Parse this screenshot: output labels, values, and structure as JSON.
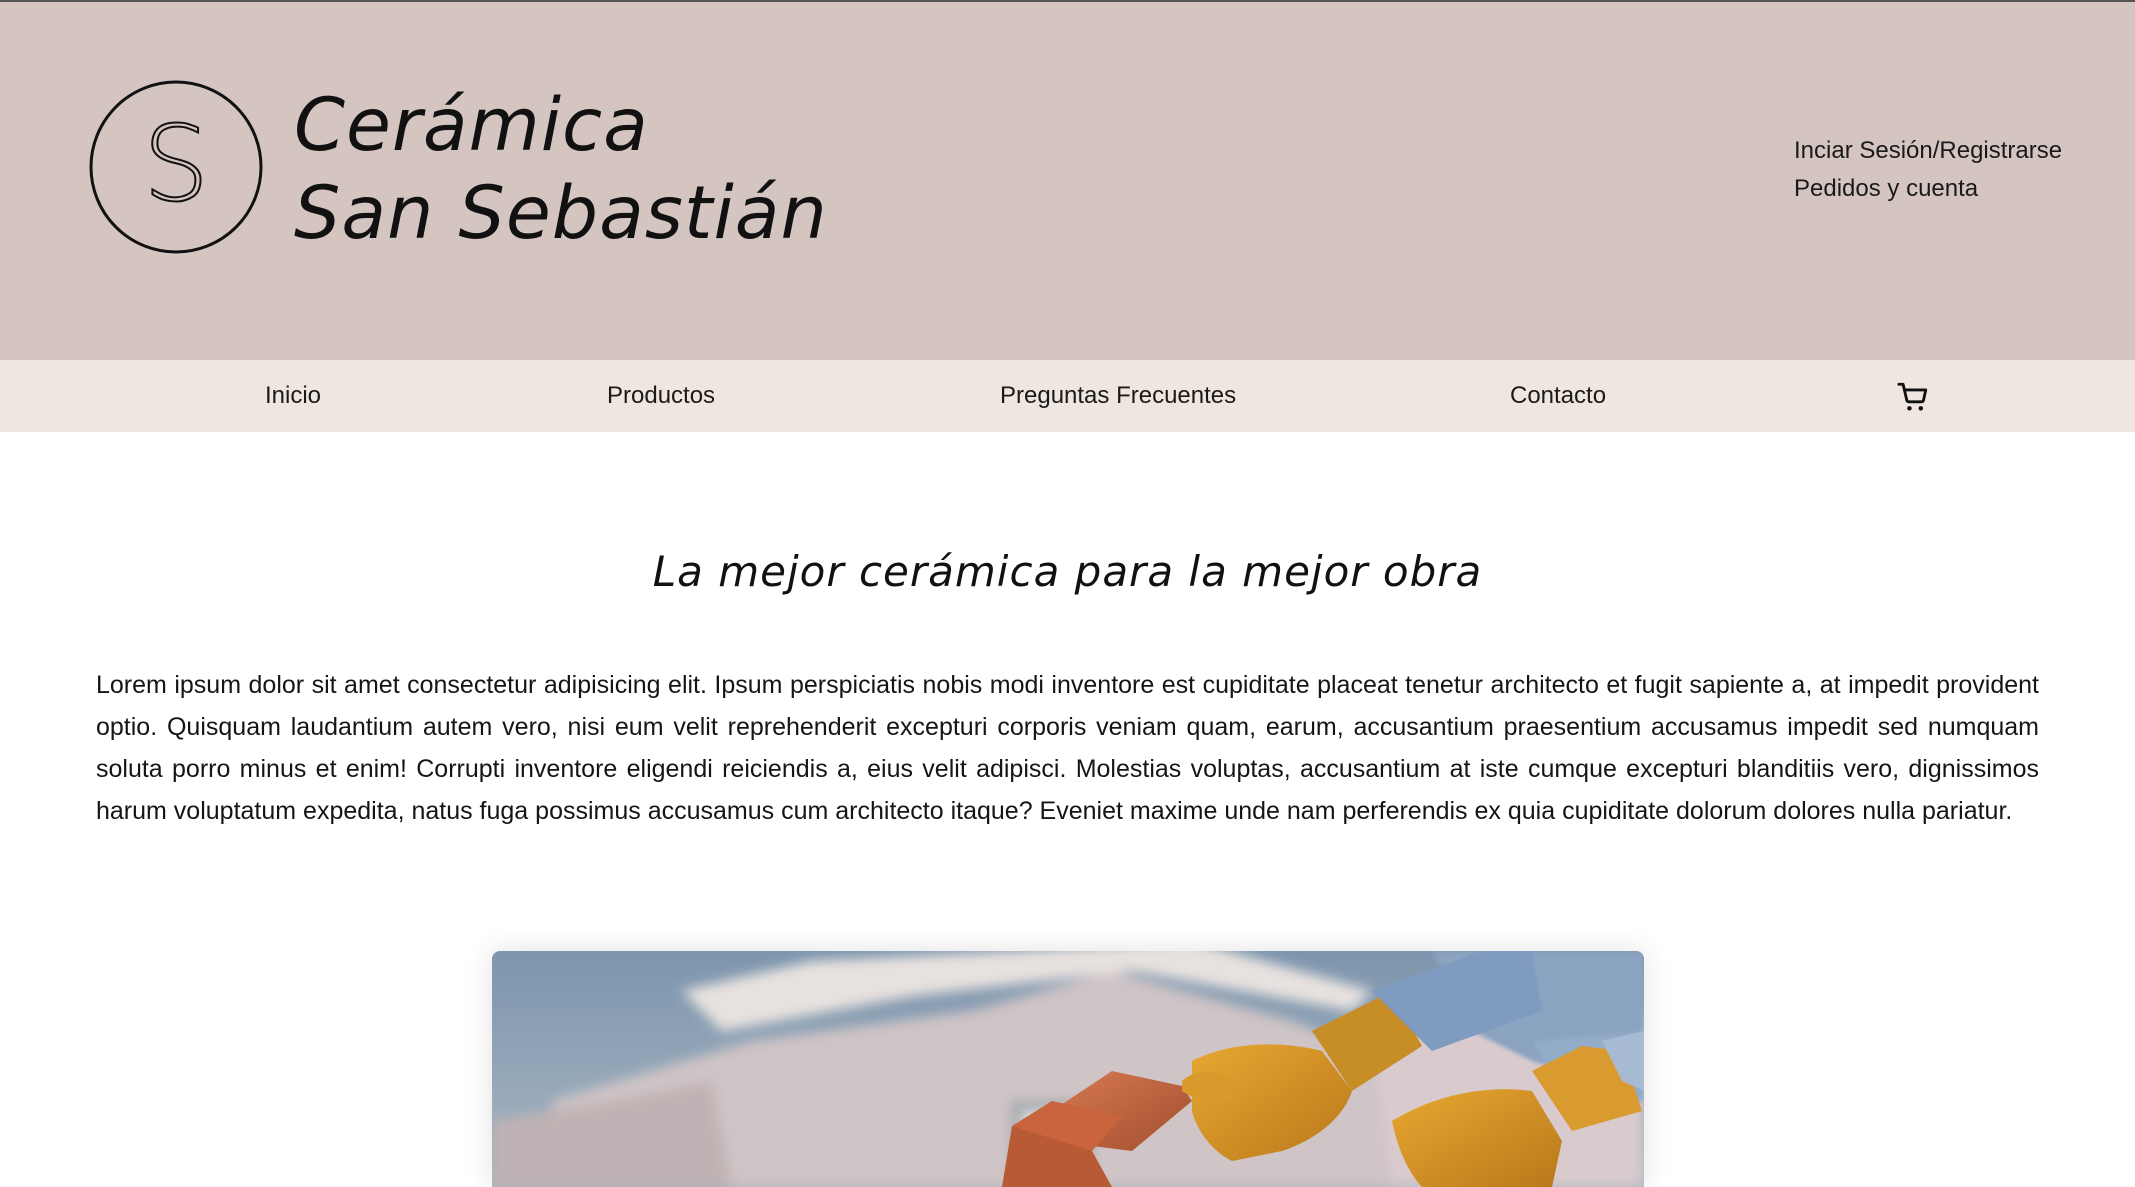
{
  "header": {
    "logo_letter": "S",
    "brand_line1": "Cerámica",
    "brand_line2": "San Sebastián",
    "account": {
      "login_label": "Inciar Sesión/Registrarse",
      "orders_label": "Pedidos y cuenta"
    },
    "background_color": "#d4c5c1"
  },
  "nav": {
    "items": [
      {
        "label": "Inicio"
      },
      {
        "label": "Productos"
      },
      {
        "label": "Preguntas Frecuentes"
      },
      {
        "label": "Contacto"
      }
    ],
    "cart_icon": "shopping-cart-icon",
    "background_color": "#efe6df"
  },
  "main": {
    "title": "La mejor cerámica para la mejor obra",
    "intro": "Lorem ipsum dolor sit amet consectetur adipisicing elit. Ipsum perspiciatis nobis modi inventore est cupiditate placeat tenetur architecto et fugit sapiente a, at impedit provident optio. Quisquam laudantium autem vero, nisi eum velit reprehenderit excepturi corporis veniam quam, earum, accusantium praesentium accusamus impedit sed numquam soluta porro minus et enim! Corrupti inventore eligendi reiciendis a, eius velit adipisci. Molestias voluptas, accusantium at iste cumque excepturi blanditiis vero, dignissimos harum voluptatum expedita, natus fuga possimus accusamus cum architecto itaque? Eveniet maxime unde nam perferendis ex quia cupiditate dolorum dolores nulla pariatur."
  }
}
